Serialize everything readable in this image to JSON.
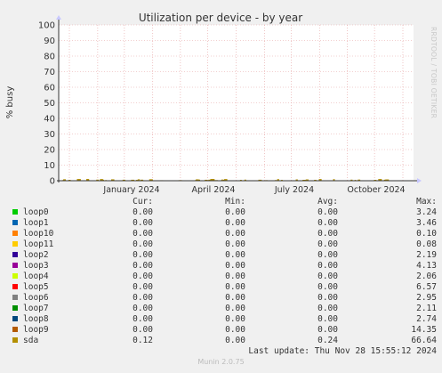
{
  "chart_data": {
    "type": "line",
    "title": "Utilization per device - by year",
    "ylabel": "% busy",
    "xlabel": "",
    "ylim": [
      0,
      100
    ],
    "y_ticks": [
      "0",
      "10",
      "20",
      "30",
      "40",
      "50",
      "60",
      "70",
      "80",
      "90",
      "100"
    ],
    "x_ticks": [
      "January 2024",
      "April 2024",
      "July 2024",
      "October 2024"
    ],
    "grid": true,
    "series_note": "All series remain near 0% across the year."
  },
  "watermark": "RRDTOOL / TOBI OETIKER",
  "legend": {
    "headers": {
      "cur": "Cur:",
      "min": "Min:",
      "avg": "Avg:",
      "max": "Max:"
    },
    "rows": [
      {
        "name": "loop0",
        "color": "#00cc00",
        "cur": "0.00",
        "min": "0.00",
        "avg": "0.00",
        "max": "3.24"
      },
      {
        "name": "loop1",
        "color": "#0066b3",
        "cur": "0.00",
        "min": "0.00",
        "avg": "0.00",
        "max": "3.46"
      },
      {
        "name": "loop10",
        "color": "#ff8000",
        "cur": "0.00",
        "min": "0.00",
        "avg": "0.00",
        "max": "0.10"
      },
      {
        "name": "loop11",
        "color": "#ffcc00",
        "cur": "0.00",
        "min": "0.00",
        "avg": "0.00",
        "max": "0.08"
      },
      {
        "name": "loop2",
        "color": "#330099",
        "cur": "0.00",
        "min": "0.00",
        "avg": "0.00",
        "max": "2.19"
      },
      {
        "name": "loop3",
        "color": "#990099",
        "cur": "0.00",
        "min": "0.00",
        "avg": "0.00",
        "max": "4.13"
      },
      {
        "name": "loop4",
        "color": "#ccff00",
        "cur": "0.00",
        "min": "0.00",
        "avg": "0.00",
        "max": "2.06"
      },
      {
        "name": "loop5",
        "color": "#ff0000",
        "cur": "0.00",
        "min": "0.00",
        "avg": "0.00",
        "max": "6.57"
      },
      {
        "name": "loop6",
        "color": "#808080",
        "cur": "0.00",
        "min": "0.00",
        "avg": "0.00",
        "max": "2.95"
      },
      {
        "name": "loop7",
        "color": "#008f00",
        "cur": "0.00",
        "min": "0.00",
        "avg": "0.00",
        "max": "2.11"
      },
      {
        "name": "loop8",
        "color": "#00487d",
        "cur": "0.00",
        "min": "0.00",
        "avg": "0.00",
        "max": "2.74"
      },
      {
        "name": "loop9",
        "color": "#b35a00",
        "cur": "0.00",
        "min": "0.00",
        "avg": "0.00",
        "max": "14.35"
      },
      {
        "name": "sda",
        "color": "#b38f00",
        "cur": "0.12",
        "min": "0.00",
        "avg": "0.24",
        "max": "66.64"
      }
    ]
  },
  "last_update": "Last update: Thu Nov 28 15:55:12 2024",
  "footer": "Munin 2.0.75"
}
